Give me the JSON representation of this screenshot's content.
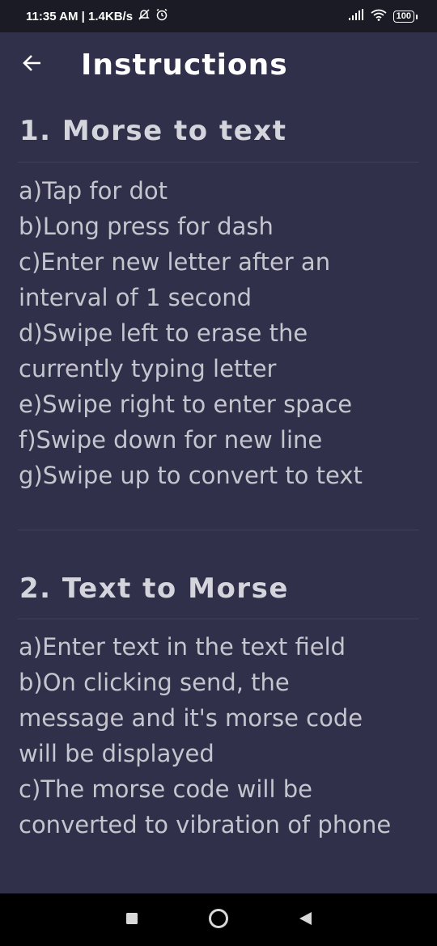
{
  "status_bar": {
    "time_speed": "11:35 AM | 1.4KB/s",
    "battery": "100"
  },
  "app_bar": {
    "title": "Instructions"
  },
  "sections": [
    {
      "title": "1. Morse to text",
      "lines": [
        "a)Tap for dot",
        "b)Long press for dash",
        "c)Enter new letter after an",
        "interval of 1 second",
        "d)Swipe left to erase the",
        "currently typing letter",
        "e)Swipe right to enter space",
        "f)Swipe down for new line",
        "g)Swipe up to convert to text"
      ]
    },
    {
      "title": "2. Text to Morse",
      "lines": [
        "a)Enter text in the text field",
        "b)On clicking send, the",
        "message and it's morse code",
        "will be displayed",
        "c)The morse code will be",
        "converted to vibration of phone"
      ]
    }
  ],
  "icons": {
    "back": "arrow-left-icon",
    "notifications_muted": "bell-off-icon",
    "alarm": "alarm-icon",
    "signal": "signal-icon",
    "wifi": "wifi-icon",
    "nav_recents": "square-icon",
    "nav_home": "circle-icon",
    "nav_back": "triangle-icon"
  },
  "colors": {
    "background": "#30304a",
    "status_bar": "#1b1b25",
    "heading": "#d4d4dc",
    "body_text": "#c5c5ce"
  }
}
